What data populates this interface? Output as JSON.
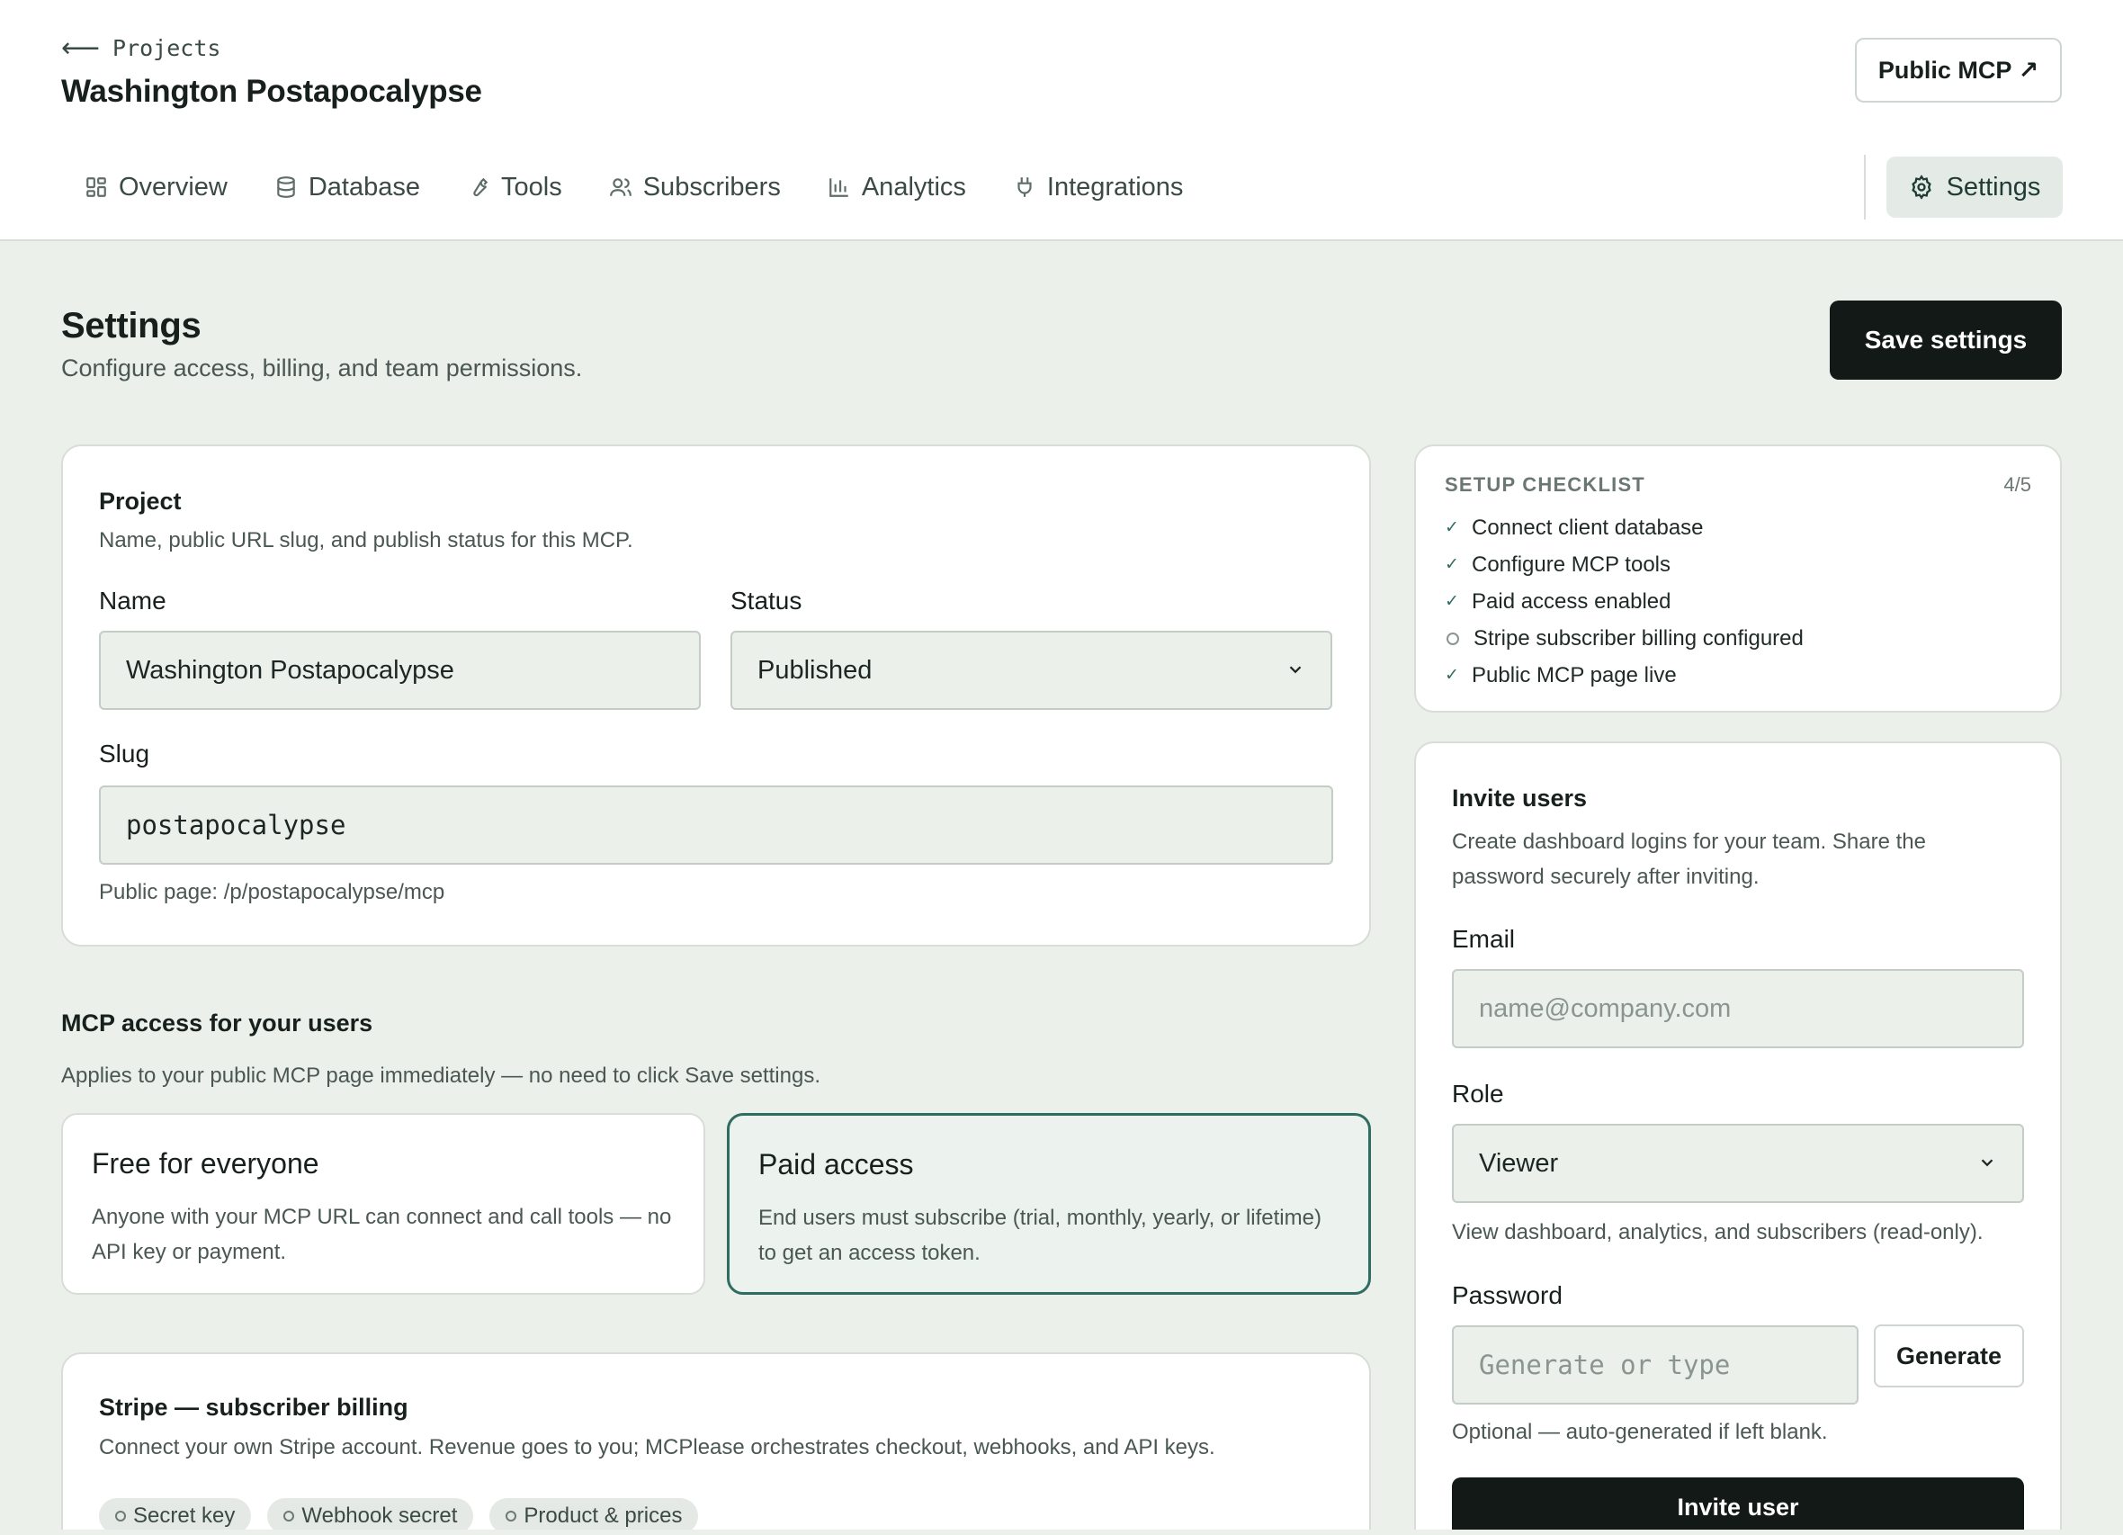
{
  "header": {
    "back_label": "Projects",
    "project_title": "Washington Postapocalypse",
    "public_button": "Public MCP ↗"
  },
  "tabs": [
    {
      "label": "Overview",
      "icon": "grid-icon"
    },
    {
      "label": "Database",
      "icon": "database-icon"
    },
    {
      "label": "Tools",
      "icon": "wrench-icon"
    },
    {
      "label": "Subscribers",
      "icon": "users-icon"
    },
    {
      "label": "Analytics",
      "icon": "bar-chart-icon"
    },
    {
      "label": "Integrations",
      "icon": "plug-icon"
    }
  ],
  "active_tab": {
    "label": "Settings",
    "icon": "gear-icon"
  },
  "page": {
    "title": "Settings",
    "subtitle": "Configure access, billing, and team permissions.",
    "save_button": "Save settings"
  },
  "project_card": {
    "title": "Project",
    "description": "Name, public URL slug, and publish status for this MCP.",
    "name_label": "Name",
    "name_value": "Washington Postapocalypse",
    "status_label": "Status",
    "status_value": "Published",
    "slug_label": "Slug",
    "slug_value": "postapocalypse",
    "public_page": "Public page: /p/postapocalypse/mcp"
  },
  "access": {
    "title": "MCP access for your users",
    "subtitle": "Applies to your public MCP page immediately — no need to click Save settings.",
    "options": [
      {
        "title": "Free for everyone",
        "description": "Anyone with your MCP URL can connect and call tools — no API key or payment.",
        "selected": false
      },
      {
        "title": "Paid access",
        "description": "End users must subscribe (trial, monthly, yearly, or lifetime) to get an access token.",
        "selected": true
      }
    ]
  },
  "stripe_card": {
    "title": "Stripe — subscriber billing",
    "description": "Connect your own Stripe account. Revenue goes to you; MCPlease orchestrates checkout, webhooks, and API keys.",
    "chips": [
      "Secret key",
      "Webhook secret",
      "Product & prices"
    ]
  },
  "checklist": {
    "title": "SETUP CHECKLIST",
    "count": "4/5",
    "items": [
      {
        "label": "Connect client database",
        "done": true
      },
      {
        "label": "Configure MCP tools",
        "done": true
      },
      {
        "label": "Paid access enabled",
        "done": true
      },
      {
        "label": "Stripe subscriber billing configured",
        "done": false
      },
      {
        "label": "Public MCP page live",
        "done": true
      }
    ]
  },
  "invite": {
    "title": "Invite users",
    "description": "Create dashboard logins for your team. Share the password securely after inviting.",
    "email_label": "Email",
    "email_placeholder": "name@company.com",
    "role_label": "Role",
    "role_value": "Viewer",
    "role_hint": "View dashboard, analytics, and subscribers (read-only).",
    "password_label": "Password",
    "password_placeholder": "Generate or type",
    "generate_button": "Generate",
    "password_hint": "Optional — auto-generated if left blank.",
    "invite_button": "Invite user"
  },
  "colors": {
    "accent": "#2f6c61",
    "background": "#ecf0eb",
    "primary_button": "#121917"
  }
}
